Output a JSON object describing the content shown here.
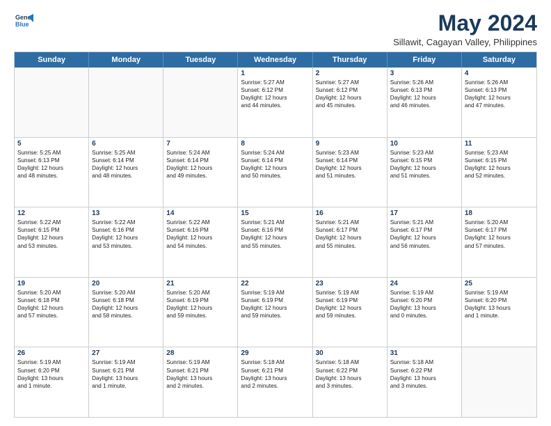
{
  "logo": {
    "line1": "General",
    "line2": "Blue"
  },
  "header": {
    "month": "May 2024",
    "location": "Sillawit, Cagayan Valley, Philippines"
  },
  "weekdays": [
    "Sunday",
    "Monday",
    "Tuesday",
    "Wednesday",
    "Thursday",
    "Friday",
    "Saturday"
  ],
  "rows": [
    [
      {
        "day": "",
        "lines": [],
        "empty": true
      },
      {
        "day": "",
        "lines": [],
        "empty": true
      },
      {
        "day": "",
        "lines": [],
        "empty": true
      },
      {
        "day": "1",
        "lines": [
          "Sunrise: 5:27 AM",
          "Sunset: 6:12 PM",
          "Daylight: 12 hours",
          "and 44 minutes."
        ]
      },
      {
        "day": "2",
        "lines": [
          "Sunrise: 5:27 AM",
          "Sunset: 6:12 PM",
          "Daylight: 12 hours",
          "and 45 minutes."
        ]
      },
      {
        "day": "3",
        "lines": [
          "Sunrise: 5:26 AM",
          "Sunset: 6:13 PM",
          "Daylight: 12 hours",
          "and 46 minutes."
        ]
      },
      {
        "day": "4",
        "lines": [
          "Sunrise: 5:26 AM",
          "Sunset: 6:13 PM",
          "Daylight: 12 hours",
          "and 47 minutes."
        ]
      }
    ],
    [
      {
        "day": "5",
        "lines": [
          "Sunrise: 5:25 AM",
          "Sunset: 6:13 PM",
          "Daylight: 12 hours",
          "and 48 minutes."
        ]
      },
      {
        "day": "6",
        "lines": [
          "Sunrise: 5:25 AM",
          "Sunset: 6:14 PM",
          "Daylight: 12 hours",
          "and 48 minutes."
        ]
      },
      {
        "day": "7",
        "lines": [
          "Sunrise: 5:24 AM",
          "Sunset: 6:14 PM",
          "Daylight: 12 hours",
          "and 49 minutes."
        ]
      },
      {
        "day": "8",
        "lines": [
          "Sunrise: 5:24 AM",
          "Sunset: 6:14 PM",
          "Daylight: 12 hours",
          "and 50 minutes."
        ]
      },
      {
        "day": "9",
        "lines": [
          "Sunrise: 5:23 AM",
          "Sunset: 6:14 PM",
          "Daylight: 12 hours",
          "and 51 minutes."
        ]
      },
      {
        "day": "10",
        "lines": [
          "Sunrise: 5:23 AM",
          "Sunset: 6:15 PM",
          "Daylight: 12 hours",
          "and 51 minutes."
        ]
      },
      {
        "day": "11",
        "lines": [
          "Sunrise: 5:23 AM",
          "Sunset: 6:15 PM",
          "Daylight: 12 hours",
          "and 52 minutes."
        ]
      }
    ],
    [
      {
        "day": "12",
        "lines": [
          "Sunrise: 5:22 AM",
          "Sunset: 6:15 PM",
          "Daylight: 12 hours",
          "and 53 minutes."
        ]
      },
      {
        "day": "13",
        "lines": [
          "Sunrise: 5:22 AM",
          "Sunset: 6:16 PM",
          "Daylight: 12 hours",
          "and 53 minutes."
        ]
      },
      {
        "day": "14",
        "lines": [
          "Sunrise: 5:22 AM",
          "Sunset: 6:16 PM",
          "Daylight: 12 hours",
          "and 54 minutes."
        ]
      },
      {
        "day": "15",
        "lines": [
          "Sunrise: 5:21 AM",
          "Sunset: 6:16 PM",
          "Daylight: 12 hours",
          "and 55 minutes."
        ]
      },
      {
        "day": "16",
        "lines": [
          "Sunrise: 5:21 AM",
          "Sunset: 6:17 PM",
          "Daylight: 12 hours",
          "and 55 minutes."
        ]
      },
      {
        "day": "17",
        "lines": [
          "Sunrise: 5:21 AM",
          "Sunset: 6:17 PM",
          "Daylight: 12 hours",
          "and 56 minutes."
        ]
      },
      {
        "day": "18",
        "lines": [
          "Sunrise: 5:20 AM",
          "Sunset: 6:17 PM",
          "Daylight: 12 hours",
          "and 57 minutes."
        ]
      }
    ],
    [
      {
        "day": "19",
        "lines": [
          "Sunrise: 5:20 AM",
          "Sunset: 6:18 PM",
          "Daylight: 12 hours",
          "and 57 minutes."
        ]
      },
      {
        "day": "20",
        "lines": [
          "Sunrise: 5:20 AM",
          "Sunset: 6:18 PM",
          "Daylight: 12 hours",
          "and 58 minutes."
        ]
      },
      {
        "day": "21",
        "lines": [
          "Sunrise: 5:20 AM",
          "Sunset: 6:19 PM",
          "Daylight: 12 hours",
          "and 59 minutes."
        ]
      },
      {
        "day": "22",
        "lines": [
          "Sunrise: 5:19 AM",
          "Sunset: 6:19 PM",
          "Daylight: 12 hours",
          "and 59 minutes."
        ]
      },
      {
        "day": "23",
        "lines": [
          "Sunrise: 5:19 AM",
          "Sunset: 6:19 PM",
          "Daylight: 12 hours",
          "and 59 minutes."
        ]
      },
      {
        "day": "24",
        "lines": [
          "Sunrise: 5:19 AM",
          "Sunset: 6:20 PM",
          "Daylight: 13 hours",
          "and 0 minutes."
        ]
      },
      {
        "day": "25",
        "lines": [
          "Sunrise: 5:19 AM",
          "Sunset: 6:20 PM",
          "Daylight: 13 hours",
          "and 1 minute."
        ]
      }
    ],
    [
      {
        "day": "26",
        "lines": [
          "Sunrise: 5:19 AM",
          "Sunset: 6:20 PM",
          "Daylight: 13 hours",
          "and 1 minute."
        ]
      },
      {
        "day": "27",
        "lines": [
          "Sunrise: 5:19 AM",
          "Sunset: 6:21 PM",
          "Daylight: 13 hours",
          "and 1 minute."
        ]
      },
      {
        "day": "28",
        "lines": [
          "Sunrise: 5:19 AM",
          "Sunset: 6:21 PM",
          "Daylight: 13 hours",
          "and 2 minutes."
        ]
      },
      {
        "day": "29",
        "lines": [
          "Sunrise: 5:18 AM",
          "Sunset: 6:21 PM",
          "Daylight: 13 hours",
          "and 2 minutes."
        ]
      },
      {
        "day": "30",
        "lines": [
          "Sunrise: 5:18 AM",
          "Sunset: 6:22 PM",
          "Daylight: 13 hours",
          "and 3 minutes."
        ]
      },
      {
        "day": "31",
        "lines": [
          "Sunrise: 5:18 AM",
          "Sunset: 6:22 PM",
          "Daylight: 13 hours",
          "and 3 minutes."
        ]
      },
      {
        "day": "",
        "lines": [],
        "empty": true
      }
    ]
  ]
}
